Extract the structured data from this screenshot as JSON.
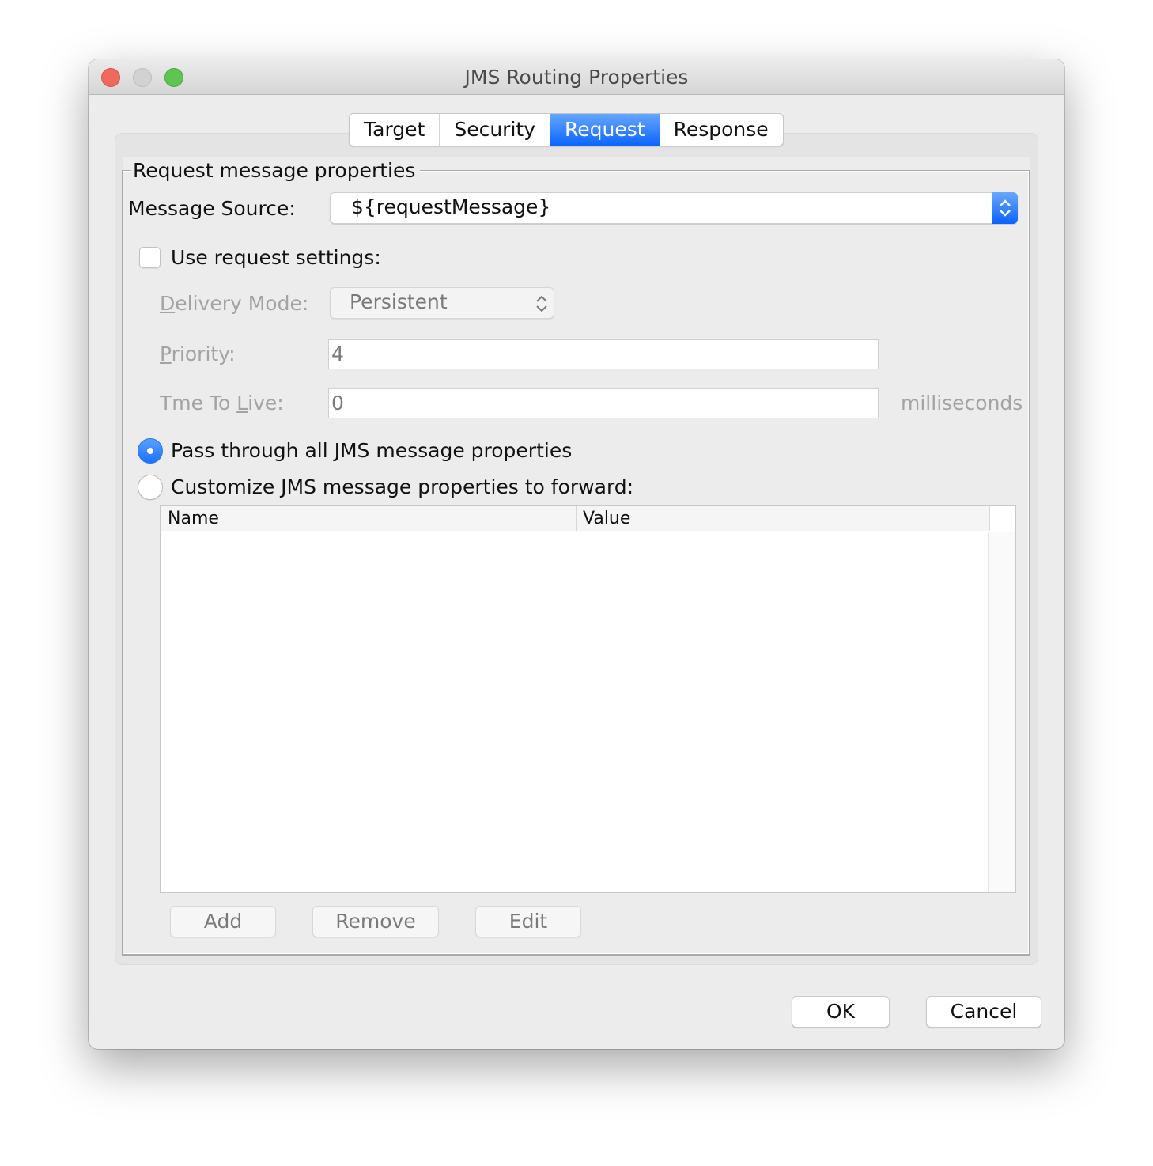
{
  "window": {
    "title": "JMS Routing Properties"
  },
  "tabs": [
    {
      "label": "Target",
      "active": false
    },
    {
      "label": "Security",
      "active": false
    },
    {
      "label": "Request",
      "active": true
    },
    {
      "label": "Response",
      "active": false
    }
  ],
  "group": {
    "legend": "Request message properties",
    "message_source_label": "Message Source:",
    "message_source_value": "${requestMessage}",
    "use_request_settings_label": "Use request settings:",
    "use_request_settings_checked": false,
    "delivery_mode_label_mnemonic": "D",
    "delivery_mode_label_rest": "elivery Mode:",
    "delivery_mode_value": "Persistent",
    "priority_label_mnemonic": "P",
    "priority_label_rest": "riority:",
    "priority_value": "4",
    "ttl_label_pre": "Tme To ",
    "ttl_label_mnemonic": "L",
    "ttl_label_rest": "ive:",
    "ttl_value": "0",
    "ttl_unit": "milliseconds",
    "radio_pass_through": "Pass through all JMS message properties",
    "radio_customize": "Customize JMS message properties to forward:",
    "selected_radio": "pass_through",
    "table": {
      "columns": [
        "Name",
        "Value"
      ],
      "rows": []
    },
    "buttons": {
      "add": "Add",
      "remove": "Remove",
      "edit": "Edit"
    }
  },
  "footer": {
    "ok": "OK",
    "cancel": "Cancel"
  },
  "colors": {
    "accent": "#0b66ff",
    "close": "#ee6a5e",
    "minimize": "#d2d2d2",
    "maximize": "#5fc454"
  }
}
